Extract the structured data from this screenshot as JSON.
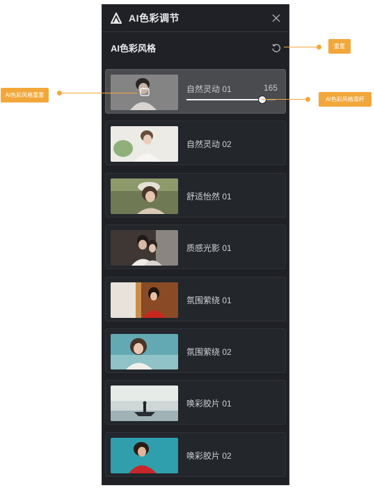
{
  "panel": {
    "title": "AI色彩调节",
    "section_title": "AI色彩风格"
  },
  "styles": [
    {
      "label": "自然灵动 01",
      "value": "165",
      "selected": true,
      "slider_fraction": 0.85
    },
    {
      "label": "自然灵动 02"
    },
    {
      "label": "舒适怡然 01"
    },
    {
      "label": "质感光影 01"
    },
    {
      "label": "氛围萦绕 01"
    },
    {
      "label": "氛围萦绕 02"
    },
    {
      "label": "唤彩胶片 01"
    },
    {
      "label": "唤彩胶片 02"
    }
  ],
  "callouts": {
    "reset": "重置",
    "style_reset": "AI色彩风格重置",
    "style_slider": "AI色彩风格滑杆"
  },
  "colors": {
    "panel_bg": "#1f2126",
    "accent": "#f2a73a",
    "selected_bg": "#494b4f"
  },
  "icons": {
    "logo": "triangle-logo-icon",
    "close": "close-icon",
    "reset": "reset-icon",
    "style_reset": "style-reset-icon"
  }
}
